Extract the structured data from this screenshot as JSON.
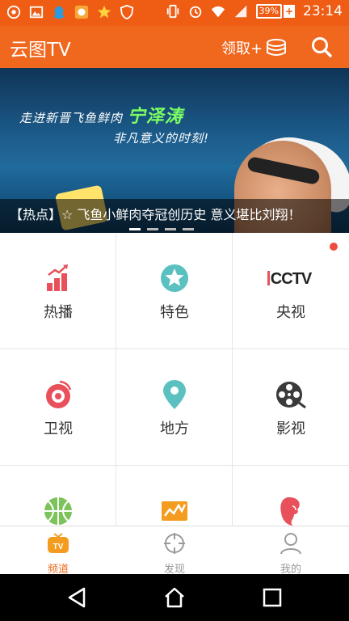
{
  "status_bar": {
    "left_icons": [
      "netease-music-icon",
      "image-icon",
      "qq-icon",
      "app-icon",
      "star-icon",
      "shield-icon"
    ],
    "right_icons": [
      "vibrate-icon",
      "alarm-icon",
      "wifi-icon",
      "signal-icon"
    ],
    "battery_percent": "39%",
    "time": "23:14"
  },
  "app_bar": {
    "title": "云图TV",
    "receive_label": "领取+",
    "coin_icon": "coin-stack-icon",
    "search_icon": "search-icon"
  },
  "banner": {
    "slogan_line1_prefix": "走进新晋飞鱼鲜肉",
    "slogan_name": "宁泽涛",
    "slogan_line2": "非凡意义的时刻!",
    "caption": "【热点】☆ 飞鱼小鲜肉夺冠创历史 意义堪比刘翔！",
    "slides": 4,
    "active_slide": 1
  },
  "grid": {
    "items": [
      {
        "label": "热播",
        "icon": "bar-chart-icon"
      },
      {
        "label": "特色",
        "icon": "star-circle-icon"
      },
      {
        "label": "央视",
        "icon": "cctv-logo"
      },
      {
        "label": "卫视",
        "icon": "satellite-dish-icon"
      },
      {
        "label": "地方",
        "icon": "map-pin-icon"
      },
      {
        "label": "影视",
        "icon": "film-reel-icon"
      },
      {
        "label": "",
        "icon": "basketball-icon"
      },
      {
        "label": "",
        "icon": "finance-chart-icon"
      },
      {
        "label": "",
        "icon": "woman-profile-icon"
      }
    ]
  },
  "bottom_nav": {
    "items": [
      {
        "label": "频道",
        "icon": "tv-icon",
        "active": true
      },
      {
        "label": "发现",
        "icon": "crosshair-icon",
        "active": false
      },
      {
        "label": "我的",
        "icon": "user-icon",
        "active": false
      }
    ]
  },
  "system_nav": {
    "back": "back-icon",
    "home": "home-icon",
    "recents": "recents-icon"
  },
  "colors": {
    "brand_orange": "#f0671e",
    "status_orange": "#ef5d14",
    "icon_red": "#e8505b",
    "icon_teal": "#5bc1c0",
    "icon_dark": "#3b3b3b",
    "icon_green": "#7cc35a"
  }
}
